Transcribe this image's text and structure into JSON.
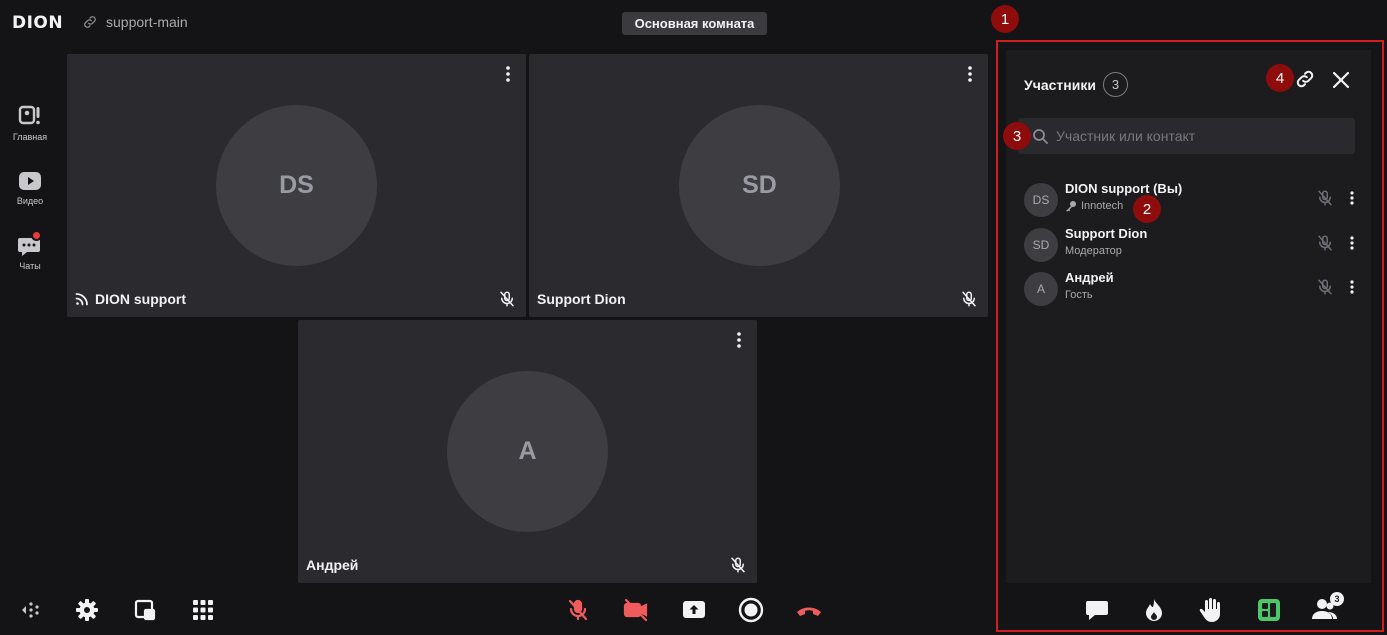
{
  "header": {
    "logo": "DION",
    "room_link": "support-main",
    "room_name": "Основная комната"
  },
  "rail": {
    "items": [
      {
        "label": "Главная",
        "icon": "home-icon"
      },
      {
        "label": "Видео",
        "icon": "video-play-icon"
      },
      {
        "label": "Чаты",
        "icon": "chat-icon",
        "has_badge": true
      }
    ]
  },
  "tiles": [
    {
      "initials": "DS",
      "name": "DION support",
      "icon": "broadcast-icon",
      "muted": true
    },
    {
      "initials": "SD",
      "name": "Support Dion",
      "muted": true
    },
    {
      "initials": "A",
      "name": "Андрей",
      "muted": true
    }
  ],
  "panel": {
    "title": "Участники",
    "count": "3",
    "search_placeholder": "Участник или контакт",
    "participants": [
      {
        "initials": "DS",
        "name": "DION support (Вы)",
        "role": "Innotech",
        "role_icon": "key-icon"
      },
      {
        "initials": "SD",
        "name": "Support Dion",
        "role": "Модератор"
      },
      {
        "initials": "A",
        "name": "Андрей",
        "role": "Гость"
      }
    ],
    "footer_icons": [
      "chat-bubble-icon",
      "reactions-icon",
      "raise-hand-icon",
      "layout-icon",
      "participants-icon"
    ],
    "footer_badge": "3"
  },
  "markers": [
    "1",
    "2",
    "3",
    "4"
  ],
  "colors": {
    "accent_red": "#d11f1f",
    "marker_red": "#8e0c0c",
    "mute_red": "#f05b5b",
    "layout_green": "#4cc76a",
    "background": "#141416",
    "tile": "#2b2b2f"
  }
}
